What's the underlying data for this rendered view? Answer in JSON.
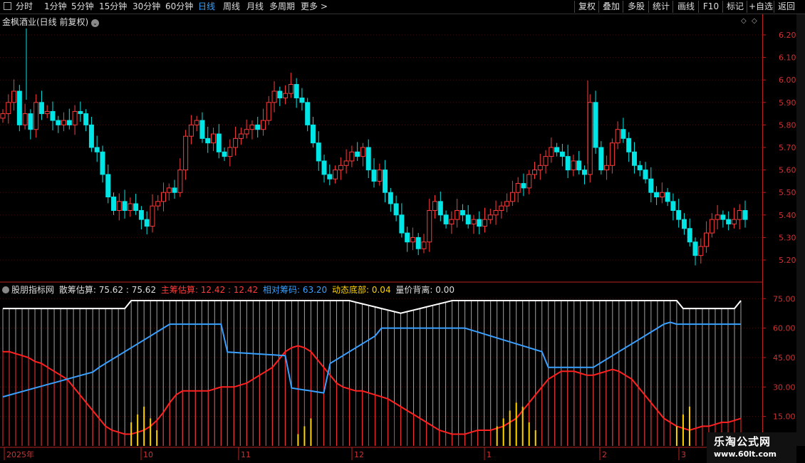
{
  "toolbar": {
    "periods": [
      "分时",
      "1分钟",
      "5分钟",
      "15分钟",
      "30分钟",
      "60分钟",
      "日线",
      "周线",
      "月线",
      "多周期",
      "更多 >"
    ],
    "active_period": "日线",
    "right_buttons": [
      "复权",
      "叠加",
      "多股",
      "统计",
      "画线",
      "F10",
      "标记",
      "+自选",
      "返回"
    ]
  },
  "main": {
    "title": "金枫酒业(日线 前复权)",
    "price_ticks": [
      "6.20",
      "6.10",
      "6.00",
      "5.90",
      "5.80",
      "5.70",
      "5.60",
      "5.50",
      "5.40",
      "5.30",
      "5.20"
    ]
  },
  "indicator": {
    "name": "股朋指标网",
    "items": [
      {
        "label": "散筹估算: 75.62 : 75.62",
        "color": "#dddddd"
      },
      {
        "label": "主筹估算: 12.42 : 12.42",
        "color": "#ff3b3b"
      },
      {
        "label": "相对筹码: 63.20",
        "color": "#3aa0ff"
      },
      {
        "label": "动态底部: 0.04",
        "color": "#ffd400"
      },
      {
        "label": "量价背离: 0.00",
        "color": "#dddddd"
      }
    ],
    "ticks": [
      "75.00",
      "60.00",
      "45.00",
      "30.00",
      "15.00"
    ]
  },
  "date_axis": [
    "2025年",
    "10",
    "11",
    "12",
    "1",
    "2",
    "3"
  ],
  "watermark": {
    "line1": "乐淘公式网",
    "line2": "www.60lt.com"
  },
  "colors": {
    "up": "#ff3b3b",
    "down": "#00e5e5",
    "white_line": "#e8e8e8",
    "blue_line": "#3aa0ff",
    "red_line": "#ff2020",
    "yellow": "#ffd400"
  },
  "chart_data": {
    "type": "candlestick",
    "ylim": [
      5.15,
      6.25
    ],
    "closes": [
      5.85,
      5.9,
      5.95,
      5.8,
      5.85,
      5.78,
      5.9,
      5.85,
      5.86,
      5.82,
      5.8,
      5.82,
      5.8,
      5.86,
      5.85,
      5.8,
      5.7,
      5.68,
      5.58,
      5.48,
      5.42,
      5.46,
      5.42,
      5.45,
      5.42,
      5.38,
      5.35,
      5.44,
      5.46,
      5.5,
      5.52,
      5.5,
      5.6,
      5.75,
      5.8,
      5.82,
      5.74,
      5.72,
      5.76,
      5.68,
      5.66,
      5.7,
      5.74,
      5.76,
      5.78,
      5.8,
      5.78,
      5.82,
      5.9,
      5.95,
      5.92,
      5.94,
      5.98,
      5.92,
      5.9,
      5.8,
      5.72,
      5.64,
      5.58,
      5.56,
      5.6,
      5.62,
      5.64,
      5.68,
      5.66,
      5.7,
      5.6,
      5.55,
      5.6,
      5.5,
      5.45,
      5.4,
      5.32,
      5.28,
      5.3,
      5.25,
      5.28,
      5.42,
      5.46,
      5.4,
      5.36,
      5.38,
      5.42,
      5.4,
      5.36,
      5.38,
      5.35,
      5.38,
      5.4,
      5.42,
      5.44,
      5.46,
      5.5,
      5.54,
      5.52,
      5.58,
      5.6,
      5.62,
      5.66,
      5.7,
      5.68,
      5.66,
      5.6,
      5.64,
      5.6,
      5.58,
      5.9,
      5.7,
      5.6,
      5.62,
      5.72,
      5.78,
      5.74,
      5.68,
      5.62,
      5.6,
      5.56,
      5.5,
      5.48,
      5.5,
      5.46,
      5.42,
      5.38,
      5.34,
      5.28,
      5.22,
      5.26,
      5.32,
      5.38,
      5.4,
      5.38,
      5.36,
      5.38,
      5.42,
      5.38
    ],
    "chip_scatter": [
      48,
      48,
      47,
      46,
      45,
      43,
      42,
      40,
      38,
      36,
      34,
      30,
      26,
      22,
      18,
      14,
      10,
      8,
      7,
      6,
      6,
      7,
      8,
      10,
      13,
      17,
      22,
      26,
      28,
      28,
      28,
      28,
      28,
      29,
      30,
      30,
      30,
      31,
      32,
      34,
      36,
      38,
      40,
      44,
      48,
      50,
      51,
      50,
      48,
      44,
      40,
      36,
      32,
      30,
      29,
      28,
      28,
      27,
      26,
      25,
      24,
      22,
      20,
      18,
      16,
      14,
      12,
      10,
      8,
      7,
      6,
      6,
      6,
      7,
      8,
      8,
      8,
      9,
      10,
      12,
      14,
      18,
      22,
      26,
      30,
      34,
      36,
      38,
      38,
      38,
      37,
      36,
      36,
      37,
      38,
      39,
      38,
      36,
      34,
      30,
      26,
      22,
      18,
      14,
      12,
      10,
      9,
      8,
      9,
      10,
      10,
      11,
      12,
      12,
      13,
      14
    ]
  }
}
